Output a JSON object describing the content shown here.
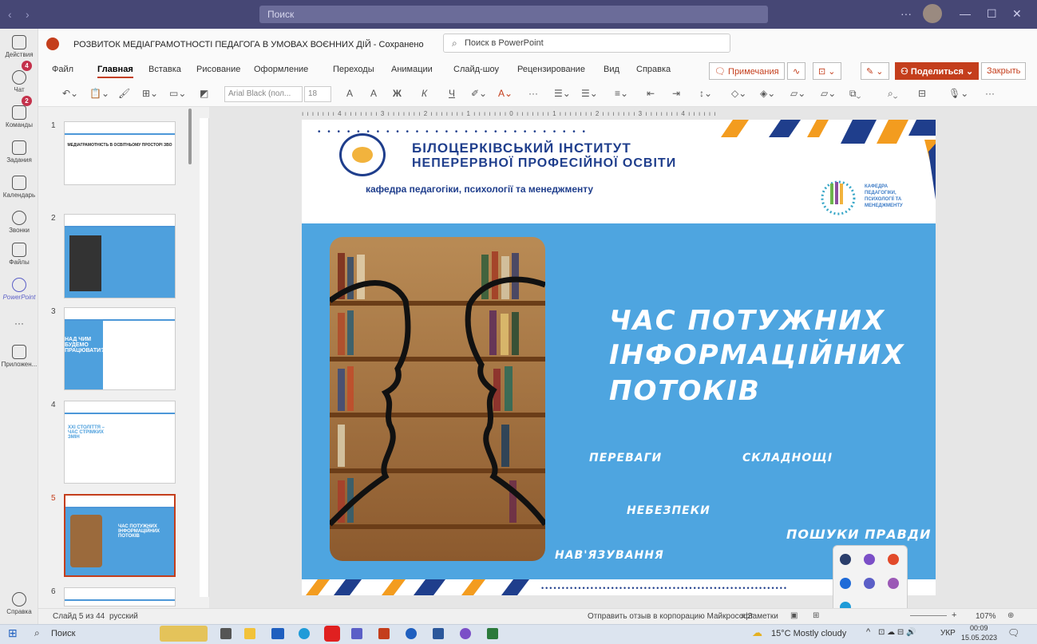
{
  "titlebar": {
    "search_placeholder": "Поиск",
    "back": "‹",
    "forward": "›",
    "more": "···",
    "minimize": "—",
    "maximize": "☐",
    "close": "✕"
  },
  "rail": [
    {
      "label": "Действия",
      "badge": "4"
    },
    {
      "label": "Чат",
      "badge": "2"
    },
    {
      "label": "Команды"
    },
    {
      "label": "Задания"
    },
    {
      "label": "Календарь"
    },
    {
      "label": "Звонки"
    },
    {
      "label": "Файлы"
    },
    {
      "label": "PowerPoint"
    },
    {
      "label": "···"
    },
    {
      "label": "Приложен..."
    },
    {
      "label": "Справка"
    }
  ],
  "document": {
    "title": "РОЗВИТОК МЕДІАГРАМОТНОСТІ ПЕДАГОГА В УМОВАХ ВОЄННИХ ДІЙ  -  Сохранено",
    "search_placeholder": "Поиск в PowerPoint"
  },
  "tabs": [
    "Файл",
    "Главная",
    "Вставка",
    "Рисование",
    "Оформление",
    "Переходы",
    "Анимации",
    "Слайд-шоу",
    "Рецензирование",
    "Вид",
    "Справка"
  ],
  "ribbon_buttons": {
    "comments": "Примечания",
    "share": "Поделиться",
    "close": "Закрыть"
  },
  "toolbar": {
    "font": "Arial Black (пол...",
    "size": "18",
    "bold": "Ж",
    "italic": "К",
    "underline": "Ч"
  },
  "thumbnails": [
    {
      "num": "1",
      "text": "МЕДІАГРАМОТНІСТЬ В ОСВІТНЬОМУ ПРОСТОРІ ЗВО"
    },
    {
      "num": "2",
      "text": ""
    },
    {
      "num": "3",
      "text": "НАД ЧИМ БУДЕМО ПРАЦЮВАТИ?"
    },
    {
      "num": "4",
      "text": "XXI СТОЛІТТЯ – ЧАС СТРІМКИХ ЗМІН"
    },
    {
      "num": "5",
      "text": "ЧАС ПОТУЖНИХ ІНФОРМАЦІЙНИХ ПОТОКІВ"
    },
    {
      "num": "6",
      "text": ""
    }
  ],
  "slide": {
    "institute_line1": "БІЛОЦЕРКІВСЬКИЙ  ІНСТИТУТ",
    "institute_line2": "НЕПЕРЕРВНОЇ ПРОФЕСІЙНОЇ ОСВІТИ",
    "department": "кафедра педагогіки, психології та менеджменту",
    "dept_logo_text": "КАФЕДРА ПЕДАГОГІКИ, ПСИХОЛОГІЇ ТА МЕНЕДЖМЕНТУ",
    "title_line1": "ЧАС ПОТУЖНИХ",
    "title_line2": "ІНФОРМАЦІЙНИХ",
    "title_line3": "ПОТОКІВ",
    "kw1": "ПЕРЕВАГИ",
    "kw2": "СКЛАДНОЩІ",
    "kw3": "НЕБЕЗПЕКИ",
    "kw4": "ПОШУКИ ПРАВДИ",
    "kw5": "НАВ'ЯЗУВАННЯ"
  },
  "statusbar": {
    "slide_info": "Слайд 5 из 44",
    "language": "русский",
    "feedback": "Отправить отзыв в корпорацию Майкрософт",
    "notes": "Заметки",
    "zoom": "107%"
  },
  "taskbar": {
    "search": "Поиск",
    "weather": "15°C  Mostly cloudy",
    "lang": "УКР",
    "time": "00:09",
    "date": "15.05.2023"
  }
}
